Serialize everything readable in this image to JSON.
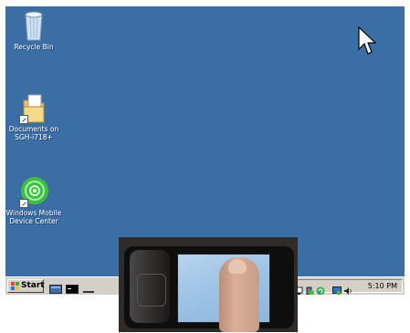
{
  "desktop": {
    "background": "#3a6ea5",
    "icons": [
      {
        "label": "Recycle Bin",
        "icon": "recycle-bin-icon"
      },
      {
        "label": "Documents on SGH-i718+",
        "icon": "folder-icon"
      },
      {
        "label": "Windows Mobile Device Center",
        "icon": "device-center-icon"
      }
    ]
  },
  "taskbar": {
    "start_label": "Start",
    "quick_launch": [
      "desktop-icon",
      "command-prompt-icon",
      "window-icon"
    ],
    "tray_icons": [
      "network-icon",
      "activesync-icon",
      "sync-icon",
      "display-icon",
      "volume-icon"
    ],
    "clock": "5:10 PM"
  },
  "overlay": {
    "icon": "phone-photo-icon"
  }
}
